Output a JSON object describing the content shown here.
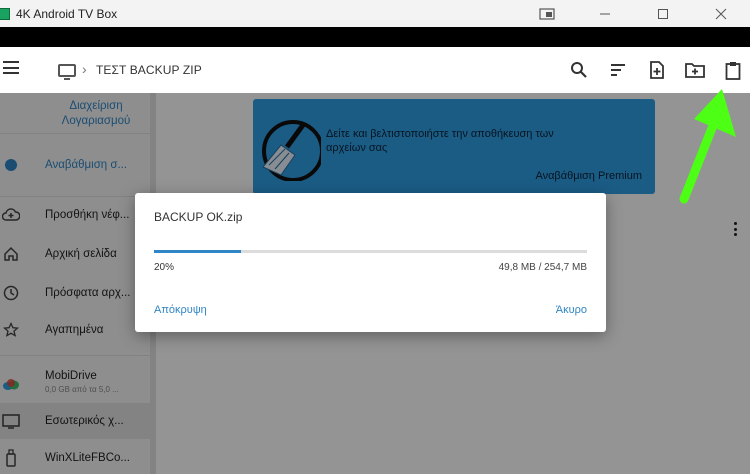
{
  "window": {
    "title": "4K Android TV Box",
    "controls": [
      "cast-icon",
      "minimize-icon",
      "maximize-icon",
      "close-icon"
    ]
  },
  "toolbar": {
    "breadcrumb_title": "ΤΕΣΤ BACKUP ZIP",
    "icons": [
      "menu-icon",
      "tv-icon",
      "search-icon",
      "sort-icon",
      "new-file-icon",
      "new-folder-icon",
      "clipboard-icon"
    ]
  },
  "sidebar": {
    "account_link": "Διαχείριση Λογαριασμού",
    "items": [
      {
        "label": "Αναβάθμιση σ...",
        "icon": "badge-icon",
        "accent": true
      },
      {
        "label": "Προσθήκη νέφ...",
        "icon": "cloud-add-icon"
      },
      {
        "label": "Αρχική σελίδα",
        "icon": "home-icon"
      },
      {
        "label": "Πρόσφατα αρχ...",
        "icon": "clock-icon"
      },
      {
        "label": "Αγαπημένα",
        "icon": "star-icon"
      },
      {
        "label": "MobiDrive",
        "sub": "0,0 GB από τα 5,0 ...",
        "icon": "mobidrive-icon"
      },
      {
        "label": "Εσωτερικός χ...",
        "icon": "tv-icon",
        "selected": true
      },
      {
        "label": "WinXLiteFBCo...",
        "icon": "usb-icon"
      }
    ]
  },
  "promo": {
    "text": "Δείτε και βελτιστοποιήστε την αποθήκευση των αρχείων σας",
    "button": "Αναβάθμιση Premium"
  },
  "dialog": {
    "title": "BACKUP OK.zip",
    "progress": 0.2,
    "percent_label": "20%",
    "size_label": "49,8 MB / 254,7 MB",
    "hide_button": "Απόκρυψη",
    "cancel_button": "Άκυρο"
  },
  "colors": {
    "accent": "#2f86c6",
    "promo_bg": "#2f9fe6",
    "arrow": "#4cff14"
  }
}
